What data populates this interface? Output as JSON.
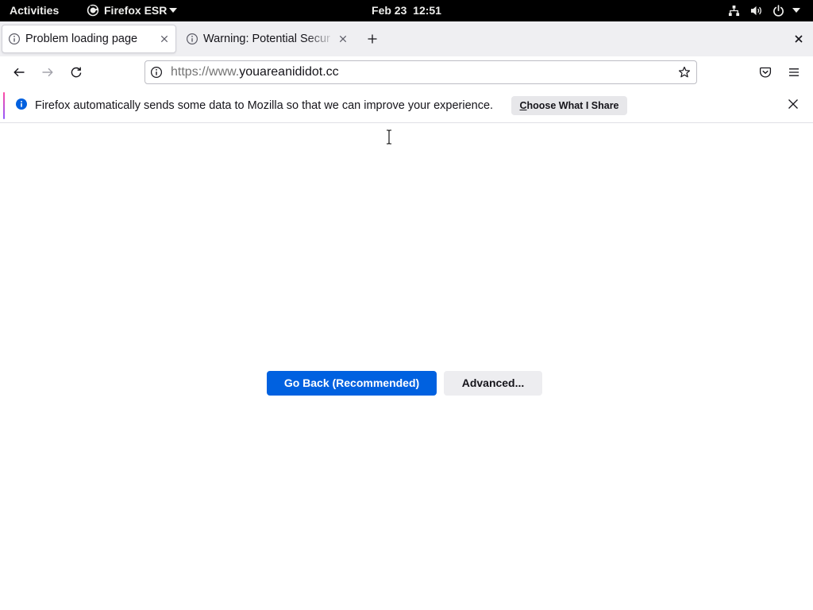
{
  "topbar": {
    "activities": "Activities",
    "app_menu": {
      "label": "Firefox ESR",
      "icon": "firefox-icon"
    },
    "clock": "Feb 23  12:51",
    "status_icons": [
      "network-wired-icon",
      "volume-icon",
      "power-icon",
      "chevron-down-icon"
    ]
  },
  "tabs": [
    {
      "title": "Problem loading page",
      "icon": "info-icon",
      "active": true
    },
    {
      "title": "Warning: Potential Secur",
      "icon": "info-icon",
      "active": false
    }
  ],
  "navbar": {
    "back": "back-arrow-icon",
    "forward": "forward-arrow-icon",
    "reload": "reload-icon",
    "url": {
      "scheme": "https://www.",
      "host": "youareanididot.cc"
    },
    "bookmark": "star-icon",
    "pocket": "pocket-icon",
    "menu": "hamburger-menu-icon"
  },
  "notification": {
    "message": "Firefox automatically sends some data to Mozilla so that we can improve your experience.",
    "button_label": "Choose What I Share"
  },
  "error_page": {
    "go_back_label": "Go Back (Recommended)",
    "advanced_label": "Advanced..."
  },
  "colors": {
    "topbar_bg": "#000000",
    "tabstrip_bg": "#efeff2",
    "accent": "#0061e0",
    "info_blue": "#0060df",
    "secondary_button": "#ededf0"
  }
}
